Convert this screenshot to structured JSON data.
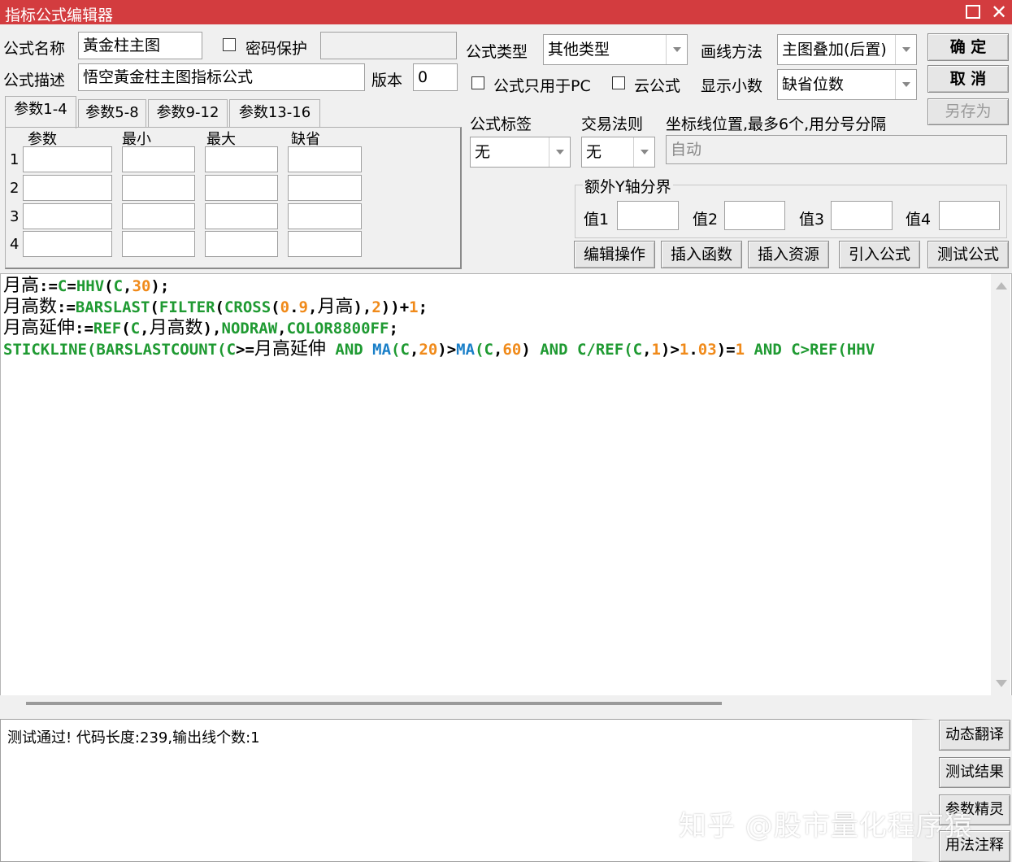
{
  "window": {
    "title": "指标公式编辑器"
  },
  "form": {
    "name_label": "公式名称",
    "name_value": "黃金柱主图",
    "password_label": "密码保护",
    "desc_label": "公式描述",
    "desc_value": "悟空黃金柱主图指标公式",
    "version_label": "版本",
    "version_value": "0",
    "type_label": "公式类型",
    "type_value": "其他类型",
    "draw_label": "画线方法",
    "draw_value": "主图叠加(后置)",
    "pc_only_label": "公式只用于PC",
    "cloud_label": "云公式",
    "decimals_label": "显示小数",
    "decimals_value": "缺省位数",
    "tag_label": "公式标签",
    "tag_value": "无",
    "rule_label": "交易法则",
    "rule_value": "无",
    "axis_label": "坐标线位置,最多6个,用分号分隔",
    "axis_value": "自动",
    "y_group_label": "额外Y轴分界",
    "y_values": [
      "值1",
      "值2",
      "值3",
      "值4"
    ]
  },
  "buttons": {
    "ok": "确  定",
    "cancel": "取  消",
    "save_as": "另存为",
    "edit_ops": "编辑操作",
    "insert_func": "插入函数",
    "insert_res": "插入资源",
    "import_formula": "引入公式",
    "test_formula": "测试公式"
  },
  "param_tabs": [
    "参数1-4",
    "参数5-8",
    "参数9-12",
    "参数13-16"
  ],
  "param_grid": {
    "headers": [
      "参数",
      "最小",
      "最大",
      "缺省"
    ],
    "rows": [
      "1",
      "2",
      "3",
      "4"
    ]
  },
  "code": {
    "line1": {
      "a": "月高",
      "b": ":=",
      "c": "C",
      "d": "=",
      "e": "HHV",
      "f": "(",
      "g": "C",
      "h": ",",
      "i": "30",
      "j": ");"
    },
    "line2": {
      "a": "月高数",
      "b": ":=",
      "c": "BARSLAST",
      "d": "(",
      "e": "FILTER",
      "f": "(",
      "g": "CROSS",
      "h": "(",
      "i": "0",
      "j": ".",
      "k": "9",
      "l": ",",
      "m": "月高",
      "n": "),",
      "o": "2",
      "p": "))",
      "q": "+",
      "r": "1",
      "s": ";"
    },
    "line3": {
      "a": "月高延伸",
      "b": ":=",
      "c": "REF",
      "d": "(",
      "e": "C",
      "f": ",",
      "g": "月高数",
      "h": "),",
      "i": "NODRAW",
      "j": ",",
      "k": "COLOR8800FF",
      "l": ";"
    },
    "line4": {
      "a": "STICKLINE",
      "b": "(",
      "c": "BARSLASTCOUNT",
      "d": "(",
      "e": "C",
      "f": ">=",
      "g": "月高延伸",
      "h": " AND ",
      "i": "MA",
      "j": "(",
      "k": "C",
      "l": ",",
      "m": "20",
      "n": ")>",
      "o": "MA",
      "p": "(",
      "q": "C",
      "r": ",",
      "s": "60",
      "t": ") ",
      "u": "AND",
      "v": " C/",
      "w": "REF",
      "x": "(",
      "y": "C",
      "z": ",",
      "aa": "1",
      "ab": ")>",
      "ac": "1",
      "ad": ".",
      "ae": "03",
      "af": ")=",
      "ag": "1",
      "ah": " AND ",
      "ai": "C>REF(HHV"
    }
  },
  "result": {
    "text": "测试通过! 代码长度:239,输出线个数:1"
  },
  "side_buttons": [
    "动态翻译",
    "测试结果",
    "参数精灵",
    "用法注释"
  ],
  "watermark": "知乎 @股市量化程序猿"
}
